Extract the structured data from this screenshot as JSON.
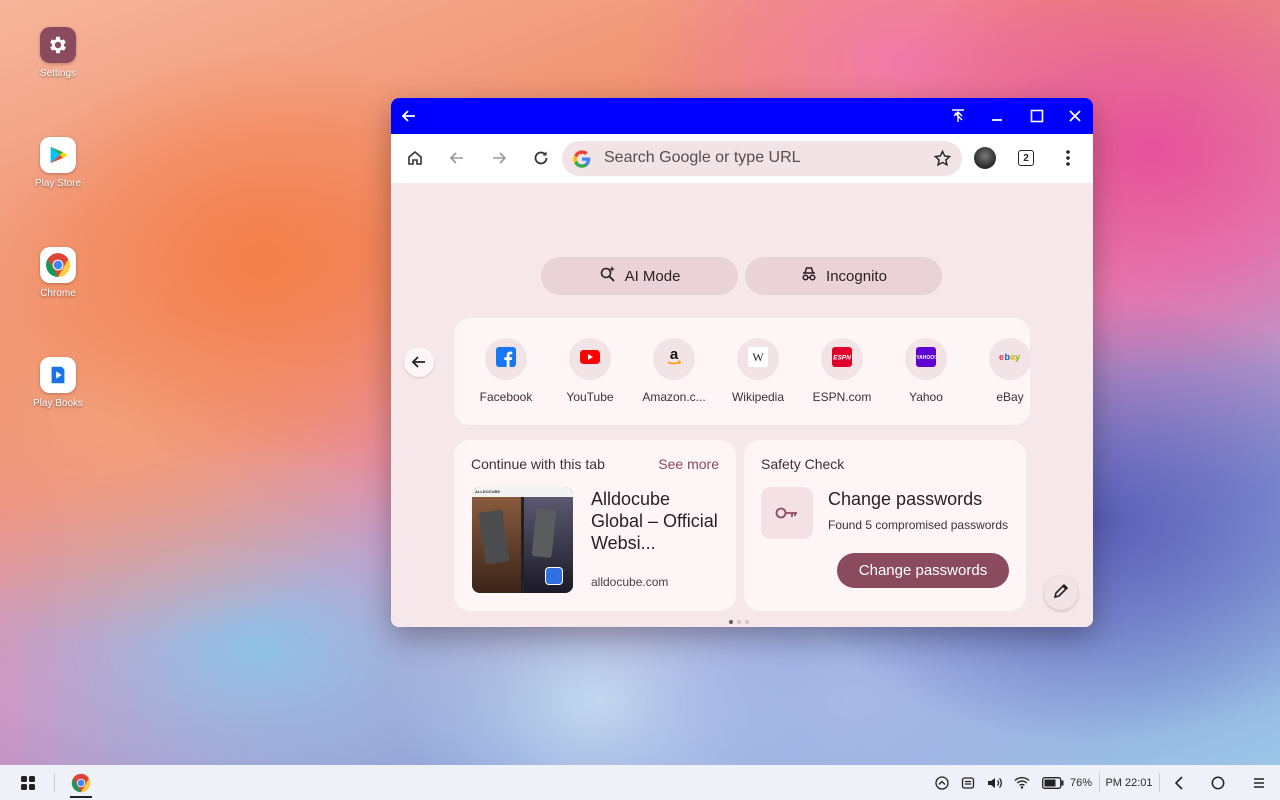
{
  "desktop": {
    "icons": [
      {
        "label": "Settings",
        "icon": "settings-gear-icon"
      },
      {
        "label": "Play Store",
        "icon": "play-store-icon"
      },
      {
        "label": "Chrome",
        "icon": "chrome-icon"
      },
      {
        "label": "Play Books",
        "icon": "play-books-icon"
      }
    ]
  },
  "window": {
    "titlebar_color": "#0000ff",
    "omnibox": {
      "placeholder": "Search Google or type URL"
    },
    "tab_count": "2",
    "pills": {
      "ai_mode": "AI Mode",
      "incognito": "Incognito"
    },
    "shortcuts": [
      {
        "name": "Facebook",
        "icon": "facebook-icon"
      },
      {
        "name": "YouTube",
        "icon": "youtube-icon"
      },
      {
        "name": "Amazon.c...",
        "icon": "amazon-icon"
      },
      {
        "name": "Wikipedia",
        "icon": "wikipedia-icon"
      },
      {
        "name": "ESPN.com",
        "icon": "espn-icon"
      },
      {
        "name": "Yahoo",
        "icon": "yahoo-icon"
      },
      {
        "name": "eBay",
        "icon": "ebay-icon"
      }
    ],
    "continue_card": {
      "title": "Continue with this tab",
      "see_more": "See more",
      "tab_title": "Alldocube Global – Official Websi...",
      "tab_url": "alldocube.com",
      "thumb_brand": "ALLDOCUBE"
    },
    "safety_card": {
      "title": "Safety Check",
      "heading": "Change passwords",
      "subtext": "Found 5 compromised passwords",
      "button": "Change passwords"
    },
    "accent": "#8a4b5f"
  },
  "taskbar": {
    "battery": "76%",
    "time": "PM 22:01"
  }
}
